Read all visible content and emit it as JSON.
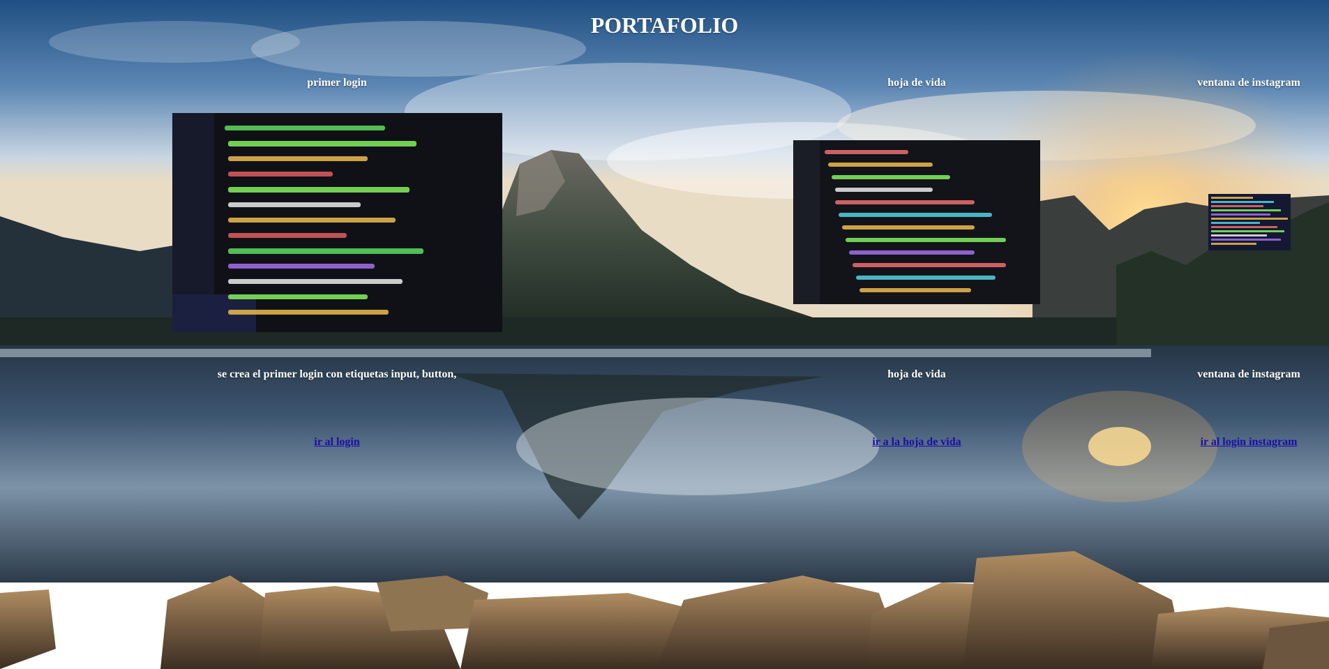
{
  "page": {
    "title": "PORTAFOLIO"
  },
  "projects": [
    {
      "heading": "primer login",
      "image": "code-screenshot-python",
      "description": "se crea el primer login con etiquetas input, button,",
      "link_label": "ir al login"
    },
    {
      "heading": "hoja de vida",
      "image": "code-screenshot-javascript",
      "description": "hoja de vida",
      "link_label": "ir a la hoja de vida"
    },
    {
      "heading": "ventana de instagram",
      "image": "code-screenshot-small",
      "description": "ventana de instagram",
      "link_label": "ir al login instagram"
    }
  ],
  "colors": {
    "link": "#1a0dab",
    "text": "#ffffff"
  }
}
